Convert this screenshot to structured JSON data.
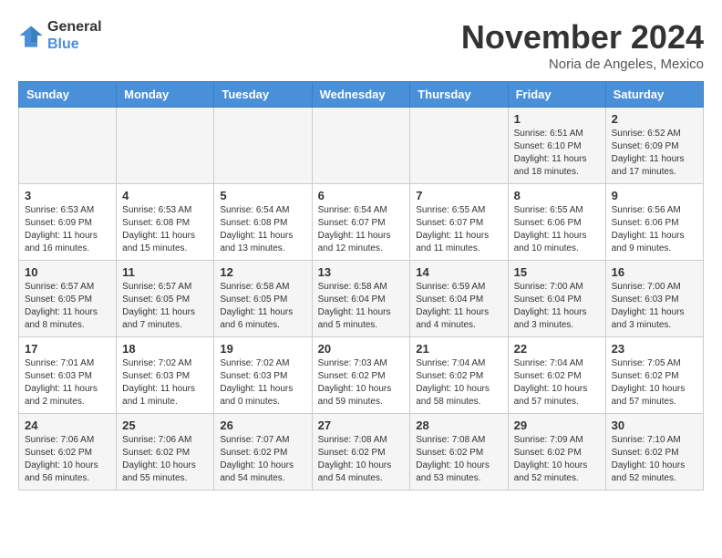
{
  "header": {
    "logo_line1": "General",
    "logo_line2": "Blue",
    "month_title": "November 2024",
    "location": "Noria de Angeles, Mexico"
  },
  "weekdays": [
    "Sunday",
    "Monday",
    "Tuesday",
    "Wednesday",
    "Thursday",
    "Friday",
    "Saturday"
  ],
  "weeks": [
    [
      {
        "day": "",
        "info": ""
      },
      {
        "day": "",
        "info": ""
      },
      {
        "day": "",
        "info": ""
      },
      {
        "day": "",
        "info": ""
      },
      {
        "day": "",
        "info": ""
      },
      {
        "day": "1",
        "info": "Sunrise: 6:51 AM\nSunset: 6:10 PM\nDaylight: 11 hours\nand 18 minutes."
      },
      {
        "day": "2",
        "info": "Sunrise: 6:52 AM\nSunset: 6:09 PM\nDaylight: 11 hours\nand 17 minutes."
      }
    ],
    [
      {
        "day": "3",
        "info": "Sunrise: 6:53 AM\nSunset: 6:09 PM\nDaylight: 11 hours\nand 16 minutes."
      },
      {
        "day": "4",
        "info": "Sunrise: 6:53 AM\nSunset: 6:08 PM\nDaylight: 11 hours\nand 15 minutes."
      },
      {
        "day": "5",
        "info": "Sunrise: 6:54 AM\nSunset: 6:08 PM\nDaylight: 11 hours\nand 13 minutes."
      },
      {
        "day": "6",
        "info": "Sunrise: 6:54 AM\nSunset: 6:07 PM\nDaylight: 11 hours\nand 12 minutes."
      },
      {
        "day": "7",
        "info": "Sunrise: 6:55 AM\nSunset: 6:07 PM\nDaylight: 11 hours\nand 11 minutes."
      },
      {
        "day": "8",
        "info": "Sunrise: 6:55 AM\nSunset: 6:06 PM\nDaylight: 11 hours\nand 10 minutes."
      },
      {
        "day": "9",
        "info": "Sunrise: 6:56 AM\nSunset: 6:06 PM\nDaylight: 11 hours\nand 9 minutes."
      }
    ],
    [
      {
        "day": "10",
        "info": "Sunrise: 6:57 AM\nSunset: 6:05 PM\nDaylight: 11 hours\nand 8 minutes."
      },
      {
        "day": "11",
        "info": "Sunrise: 6:57 AM\nSunset: 6:05 PM\nDaylight: 11 hours\nand 7 minutes."
      },
      {
        "day": "12",
        "info": "Sunrise: 6:58 AM\nSunset: 6:05 PM\nDaylight: 11 hours\nand 6 minutes."
      },
      {
        "day": "13",
        "info": "Sunrise: 6:58 AM\nSunset: 6:04 PM\nDaylight: 11 hours\nand 5 minutes."
      },
      {
        "day": "14",
        "info": "Sunrise: 6:59 AM\nSunset: 6:04 PM\nDaylight: 11 hours\nand 4 minutes."
      },
      {
        "day": "15",
        "info": "Sunrise: 7:00 AM\nSunset: 6:04 PM\nDaylight: 11 hours\nand 3 minutes."
      },
      {
        "day": "16",
        "info": "Sunrise: 7:00 AM\nSunset: 6:03 PM\nDaylight: 11 hours\nand 3 minutes."
      }
    ],
    [
      {
        "day": "17",
        "info": "Sunrise: 7:01 AM\nSunset: 6:03 PM\nDaylight: 11 hours\nand 2 minutes."
      },
      {
        "day": "18",
        "info": "Sunrise: 7:02 AM\nSunset: 6:03 PM\nDaylight: 11 hours\nand 1 minute."
      },
      {
        "day": "19",
        "info": "Sunrise: 7:02 AM\nSunset: 6:03 PM\nDaylight: 11 hours\nand 0 minutes."
      },
      {
        "day": "20",
        "info": "Sunrise: 7:03 AM\nSunset: 6:02 PM\nDaylight: 10 hours\nand 59 minutes."
      },
      {
        "day": "21",
        "info": "Sunrise: 7:04 AM\nSunset: 6:02 PM\nDaylight: 10 hours\nand 58 minutes."
      },
      {
        "day": "22",
        "info": "Sunrise: 7:04 AM\nSunset: 6:02 PM\nDaylight: 10 hours\nand 57 minutes."
      },
      {
        "day": "23",
        "info": "Sunrise: 7:05 AM\nSunset: 6:02 PM\nDaylight: 10 hours\nand 57 minutes."
      }
    ],
    [
      {
        "day": "24",
        "info": "Sunrise: 7:06 AM\nSunset: 6:02 PM\nDaylight: 10 hours\nand 56 minutes."
      },
      {
        "day": "25",
        "info": "Sunrise: 7:06 AM\nSunset: 6:02 PM\nDaylight: 10 hours\nand 55 minutes."
      },
      {
        "day": "26",
        "info": "Sunrise: 7:07 AM\nSunset: 6:02 PM\nDaylight: 10 hours\nand 54 minutes."
      },
      {
        "day": "27",
        "info": "Sunrise: 7:08 AM\nSunset: 6:02 PM\nDaylight: 10 hours\nand 54 minutes."
      },
      {
        "day": "28",
        "info": "Sunrise: 7:08 AM\nSunset: 6:02 PM\nDaylight: 10 hours\nand 53 minutes."
      },
      {
        "day": "29",
        "info": "Sunrise: 7:09 AM\nSunset: 6:02 PM\nDaylight: 10 hours\nand 52 minutes."
      },
      {
        "day": "30",
        "info": "Sunrise: 7:10 AM\nSunset: 6:02 PM\nDaylight: 10 hours\nand 52 minutes."
      }
    ]
  ]
}
